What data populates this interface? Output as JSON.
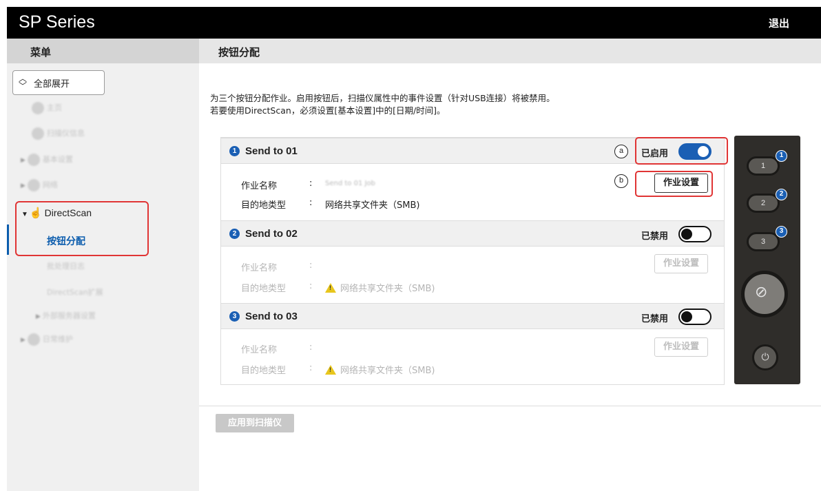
{
  "app": {
    "title": "SP Series",
    "logout_label": "退出"
  },
  "subbar": {
    "menu_label": "菜单",
    "page_title": "按钮分配"
  },
  "sidebar": {
    "expand_all_label": "全部展开",
    "blurred_items": [
      "主页",
      "扫描仪信息",
      "基本设置",
      "网络",
      "批处理日志",
      "DirectScan扩展",
      "外部服务器设置",
      "日常维护"
    ],
    "directscan_label": "DirectScan",
    "active_item_label": "按钮分配"
  },
  "main": {
    "description_line1": "为三个按钮分配作业。启用按钮后，扫描仪属性中的事件设置（针对USB连接）将被禁用。",
    "description_line2": "若要使用DirectScan，必须设置[基本设置]中的[日期/时间]。",
    "sections": [
      {
        "number": "1",
        "name": "Send to 01",
        "state": "已启用",
        "enabled": true,
        "job_name_label": "作业名称",
        "job_name_value": "Send to 01 Job",
        "dest_label": "目的地类型",
        "dest_value": "网络共享文件夹（SMB)",
        "job_button_label": "作业设置"
      },
      {
        "number": "2",
        "name": "Send to 02",
        "state": "已禁用",
        "enabled": false,
        "job_name_label": "作业名称",
        "job_name_value": "",
        "dest_label": "目的地类型",
        "dest_value": "网络共享文件夹（SMB)",
        "job_button_label": "作业设置"
      },
      {
        "number": "3",
        "name": "Send to 03",
        "state": "已禁用",
        "enabled": false,
        "job_name_label": "作业名称",
        "job_name_value": "",
        "dest_label": "目的地类型",
        "dest_value": "网络共享文件夹（SMB)",
        "job_button_label": "作业设置"
      }
    ],
    "colon": ":",
    "callouts": {
      "a": "a",
      "b": "b"
    },
    "apply_button_label": "应用到扫描仪"
  },
  "scanner_panel": {
    "buttons": [
      {
        "label": "1",
        "badge": "1"
      },
      {
        "label": "2",
        "badge": "2"
      },
      {
        "label": "3",
        "badge": "3"
      }
    ],
    "start_stop_icon": "start-stop-icon",
    "power_icon": "power-icon"
  },
  "colors": {
    "accent": "#1a5fb4",
    "highlight": "#e03434",
    "header": "#000000"
  }
}
